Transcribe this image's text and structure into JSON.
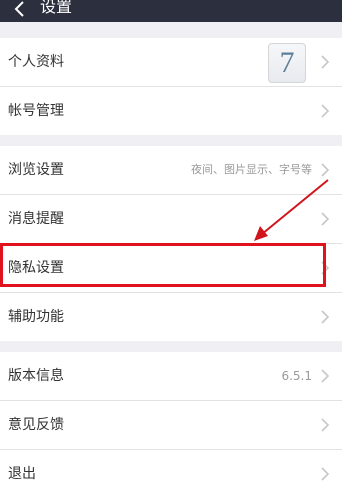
{
  "header": {
    "title": "设置"
  },
  "group1": [
    {
      "label": "个人资料",
      "avatar_text": "7"
    },
    {
      "label": "帐号管理"
    }
  ],
  "group2": [
    {
      "label": "浏览设置",
      "value": "夜间、图片显示、字号等"
    },
    {
      "label": "消息提醒"
    },
    {
      "label": "隐私设置"
    },
    {
      "label": "辅助功能"
    }
  ],
  "group3": [
    {
      "label": "版本信息",
      "value": "6.5.1"
    },
    {
      "label": "意见反馈"
    },
    {
      "label": "退出"
    }
  ],
  "colors": {
    "header_bg": "#2b2f3e",
    "highlight": "#e0121e",
    "annotation_arrow": "#d0161c"
  }
}
